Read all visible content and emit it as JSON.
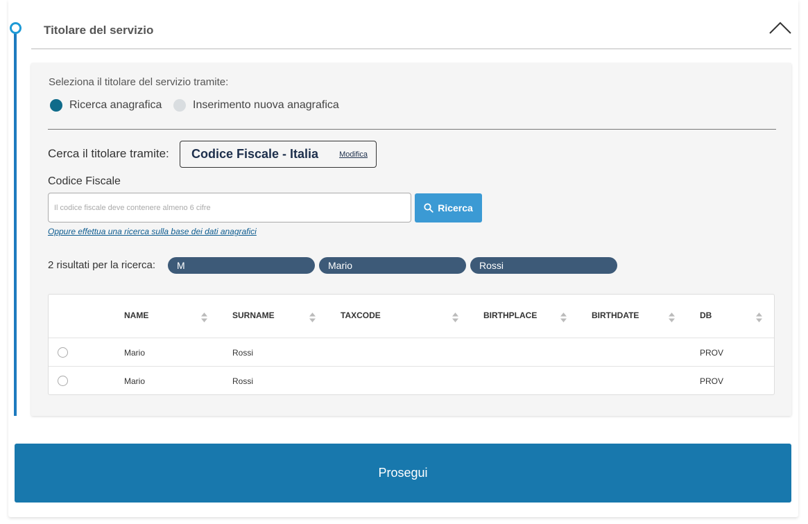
{
  "section": {
    "title": "Titolare del servizio",
    "collapse_icon": "chevron-up-icon"
  },
  "selection": {
    "label": "Seleziona il titolare del servizio tramite:",
    "options": [
      {
        "label": "Ricerca anagrafica",
        "selected": true
      },
      {
        "label": "Inserimento nuova anagrafica",
        "selected": false
      }
    ]
  },
  "search_mode": {
    "label": "Cerca il titolare tramite:",
    "value": "Codice Fiscale - Italia",
    "edit_link": "Modifica"
  },
  "codice_fiscale": {
    "label": "Codice Fiscale",
    "placeholder": "Il codice fiscale deve contenere almeno 6 cifre",
    "value": "",
    "button_label": "Ricerca",
    "button_icon": "search-icon",
    "alt_link": "Oppure effettua una ricerca sulla base dei dati anagrafici"
  },
  "results": {
    "label": "2 risultati per la ricerca:",
    "chips": [
      "M",
      "Mario",
      "Rossi"
    ],
    "columns": [
      "NAME",
      "SURNAME",
      "TAXCODE",
      "BIRTHPLACE",
      "BIRTHDATE",
      "DB"
    ],
    "rows": [
      {
        "name": "Mario",
        "surname": "Rossi",
        "taxcode": "",
        "birthplace": "",
        "birthdate": "",
        "db": "PROV"
      },
      {
        "name": "Mario",
        "surname": "Rossi",
        "taxcode": "",
        "birthplace": "",
        "birthdate": "",
        "db": "PROV"
      }
    ]
  },
  "footer": {
    "proceed_label": "Prosegui"
  },
  "colors": {
    "accent": "#1878ad",
    "timeline": "#1e7bbf",
    "chip": "#3d5a78",
    "radio_on": "#0f6b8a"
  }
}
